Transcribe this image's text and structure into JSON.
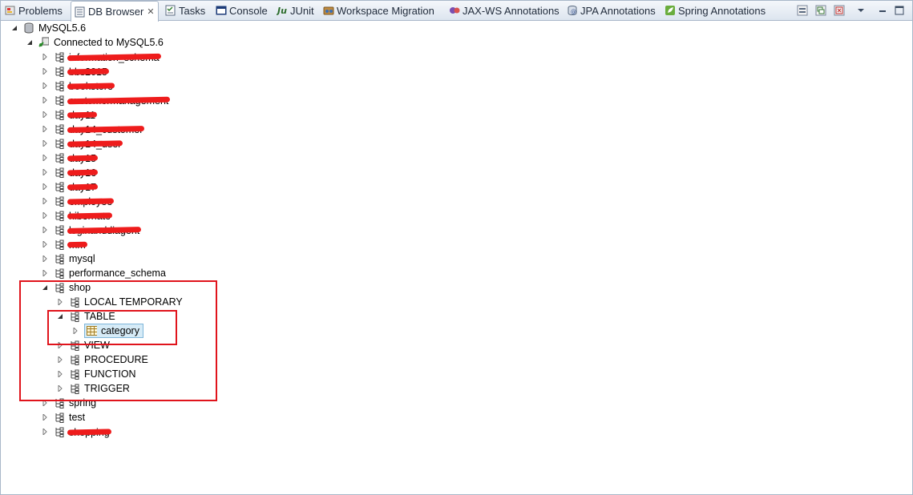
{
  "tabs": [
    {
      "label": "Problems",
      "icon": "problems-icon"
    },
    {
      "label": "DB Browser",
      "icon": "db-browser-icon",
      "active": true,
      "close": "✕"
    },
    {
      "label": "Tasks",
      "icon": "tasks-icon"
    },
    {
      "label": "Console",
      "icon": "console-icon"
    },
    {
      "label": "JUnit",
      "icon": "junit-icon"
    },
    {
      "label": "Workspace Migration",
      "icon": "workspace-migration-icon"
    },
    {
      "label": "JAX-WS Annotations",
      "icon": "jaxws-icon"
    },
    {
      "label": "JPA Annotations",
      "icon": "jpa-icon"
    },
    {
      "label": "Spring Annotations",
      "icon": "spring-icon"
    }
  ],
  "toolbar": [
    "minimize-view-icon",
    "restore-view-icon",
    "maximize-view-icon",
    "view-menu-icon"
  ],
  "tree": {
    "root": "MySQL5.6",
    "connection": "Connected to MySQL5.6",
    "schemas": {
      "s1": "information_schema",
      "s2": "bbs2015",
      "s3": "bookstore",
      "s4": "customermanagement",
      "s5": "day11",
      "s6": "day14_customer",
      "s7": "day14_user",
      "s8": "day15",
      "s9": "day16",
      "s10": "day17",
      "s11": "employee",
      "s12": "hibernate",
      "s13": "loginanddiagent",
      "s14": "mm",
      "mysql": "mysql",
      "performance_schema": "performance_schema",
      "shop": "shop",
      "spring": "spring",
      "test": "test",
      "last": "shopping"
    },
    "shop_children": {
      "local_temporary": "LOCAL TEMPORARY",
      "table": "TABLE",
      "category": "category",
      "view": "VIEW",
      "procedure": "PROCEDURE",
      "function": "FUNCTION",
      "trigger": "TRIGGER"
    }
  },
  "colors": {
    "highlight_box": "#e0141c",
    "redaction": "#ee1c1c",
    "selection_bg": "#d6ebf7",
    "selection_border": "#7fb6d9"
  }
}
